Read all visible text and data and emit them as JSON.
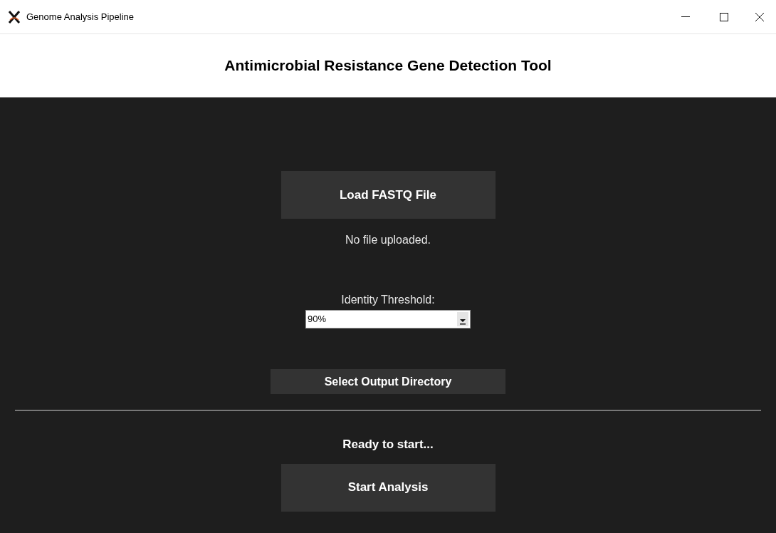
{
  "window": {
    "title": "Genome Analysis Pipeline"
  },
  "header": {
    "title": "Antimicrobial Resistance Gene Detection Tool"
  },
  "load_button": {
    "label": "Load FASTQ File"
  },
  "file_status": "No file uploaded.",
  "threshold": {
    "label": "Identity Threshold:",
    "value": "90%"
  },
  "output_button": {
    "label": "Select Output Directory"
  },
  "run_status": "Ready to start...",
  "start_button": {
    "label": "Start Analysis"
  }
}
